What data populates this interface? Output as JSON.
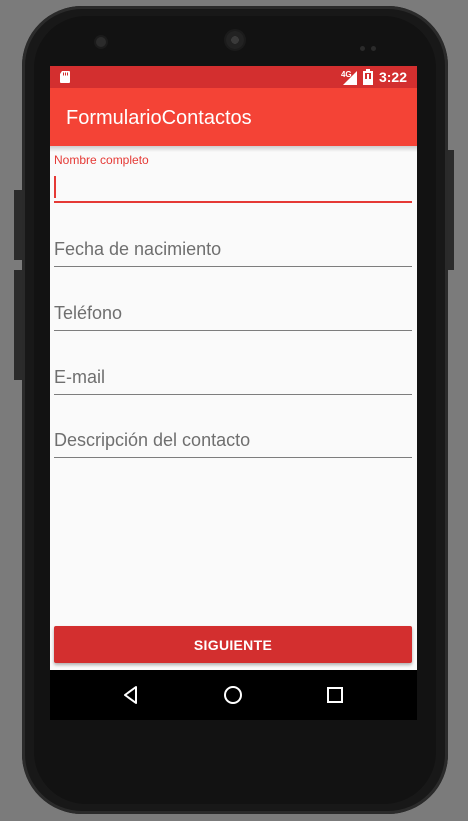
{
  "status_bar": {
    "network_type": "4G",
    "time": "3:22",
    "icons": [
      "sd-card-icon",
      "signal-icon",
      "battery-icon"
    ]
  },
  "app_bar": {
    "title": "FormularioContactos"
  },
  "form": {
    "fields": [
      {
        "name": "nombre",
        "label": "Nombre completo",
        "value": "",
        "focused": true
      },
      {
        "name": "fecha",
        "placeholder": "Fecha de nacimiento",
        "value": ""
      },
      {
        "name": "telefono",
        "placeholder": "Teléfono",
        "value": ""
      },
      {
        "name": "email",
        "placeholder": "E-mail",
        "value": ""
      },
      {
        "name": "descripcion",
        "placeholder": "Descripción del contacto",
        "value": ""
      }
    ],
    "submit_label": "SIGUIENTE"
  },
  "nav_bar": {
    "icons": [
      "back-icon",
      "home-icon",
      "recents-icon"
    ]
  },
  "colors": {
    "status_bar": "#d32f2f",
    "app_bar": "#f44336",
    "accent": "#e53935",
    "button": "#d32f2f"
  }
}
